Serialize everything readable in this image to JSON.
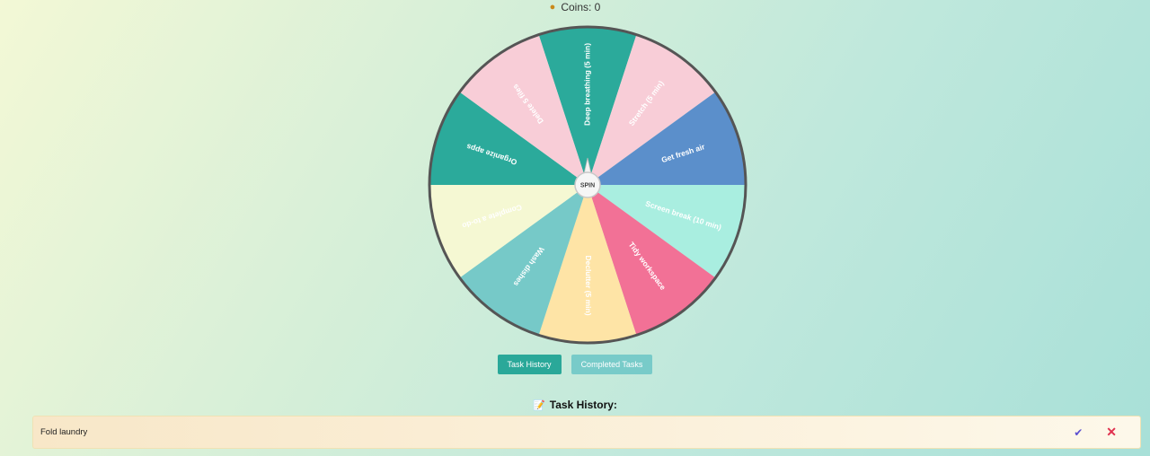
{
  "coins": {
    "icon": "money-bag-icon",
    "label": "Coins: 0"
  },
  "wheel": {
    "spin_label": "SPIN",
    "colors": {
      "teal": "#2baa9b",
      "pink": "#f8cdd7",
      "blue": "#5b8fcb",
      "mint": "#a9eee0",
      "rose": "#f27196",
      "peach": "#fee4a6",
      "sea": "#76c9c8",
      "cream": "#f5f8d3",
      "rim": "#555555"
    },
    "segments": [
      {
        "label": "Deep breathing (5 min)",
        "color": "#2baa9b",
        "text_color": "#ffffff"
      },
      {
        "label": "Stretch (5 min)",
        "color": "#f8cdd7",
        "text_color": "#ffffff"
      },
      {
        "label": "Get fresh air",
        "color": "#5b8fcb",
        "text_color": "#ffffff"
      },
      {
        "label": "Screen break (10 min)",
        "color": "#a9eee0",
        "text_color": "#ffffff"
      },
      {
        "label": "Tidy workspace",
        "color": "#f27196",
        "text_color": "#ffffff"
      },
      {
        "label": "Declutter (5 min)",
        "color": "#fee4a6",
        "text_color": "#ffffff"
      },
      {
        "label": "Wash dishes",
        "color": "#76c9c8",
        "text_color": "#ffffff"
      },
      {
        "label": "Complete a to-do",
        "color": "#f5f8d3",
        "text_color": "#ffffff"
      },
      {
        "label": "Organize apps",
        "color": "#2baa9b",
        "text_color": "#ffffff"
      },
      {
        "label": "Delete 5 files",
        "color": "#f8cdd7",
        "text_color": "#ffffff"
      }
    ]
  },
  "buttons": {
    "history": "Task History",
    "completed": "Completed Tasks"
  },
  "history": {
    "icon": "memo-icon",
    "title": "Task History:",
    "items": [
      {
        "text": "Fold laundry"
      }
    ]
  }
}
